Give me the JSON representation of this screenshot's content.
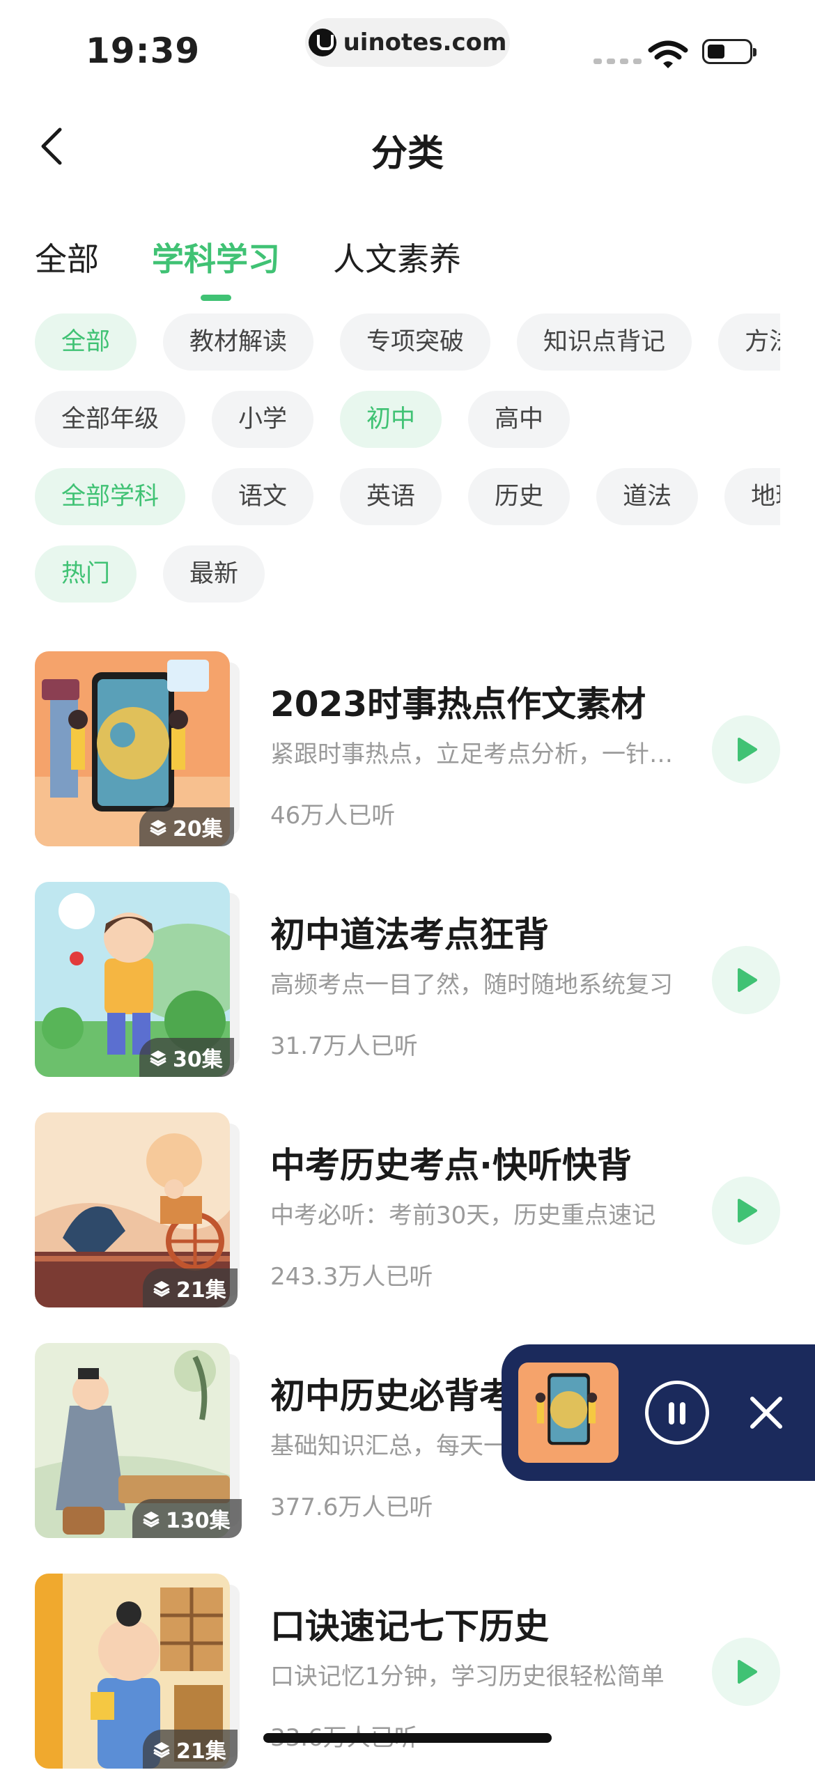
{
  "status_bar": {
    "time": "19:39",
    "url": "uinotes.com"
  },
  "header": {
    "title": "分类"
  },
  "tabs": [
    {
      "label": "全部",
      "active": false
    },
    {
      "label": "学科学习",
      "active": true
    },
    {
      "label": "人文素养",
      "active": false
    }
  ],
  "filters": {
    "type": [
      "全部",
      "教材解读",
      "专项突破",
      "知识点背记",
      "方法"
    ],
    "grade": [
      "全部年级",
      "小学",
      "初中",
      "高中"
    ],
    "subject": [
      "全部学科",
      "语文",
      "英语",
      "历史",
      "道法",
      "地理"
    ],
    "sort": [
      "热门",
      "最新"
    ]
  },
  "filter_active": {
    "type": "全部",
    "grade": "初中",
    "subject": "全部学科",
    "sort": "热门"
  },
  "list": [
    {
      "title": "2023时事热点作文素材",
      "desc": "紧跟时事热点，立足考点分析，一针见血",
      "listeners": "46万人已听",
      "episodes": "20集",
      "cover": "globe-cover-icon"
    },
    {
      "title": "初中道法考点狂背",
      "desc": "高频考点一目了然，随时随地系统复习",
      "listeners": "31.7万人已听",
      "episodes": "30集",
      "cover": "boy-reading-cover-icon"
    },
    {
      "title": "中考历史考点·快听快背",
      "desc": "中考必听：考前30天，历史重点速记",
      "listeners": "243.3万人已听",
      "episodes": "21集",
      "cover": "chariot-cover-icon"
    },
    {
      "title": "初中历史必背考点",
      "desc": "基础知识汇总，每天一点轻松掌握",
      "listeners": "377.6万人已听",
      "episodes": "130集",
      "cover": "scholar-cover-icon"
    },
    {
      "title": "口诀速记七下历史",
      "desc": "口诀记忆1分钟，学习历史很轻松简单",
      "listeners": "33.6万人已听",
      "episodes": "21集",
      "cover": "official-cover-icon"
    }
  ],
  "colors": {
    "accent": "#40c274",
    "accent_bg": "#e8f7ee",
    "player_bg": "#1b2a5c"
  }
}
